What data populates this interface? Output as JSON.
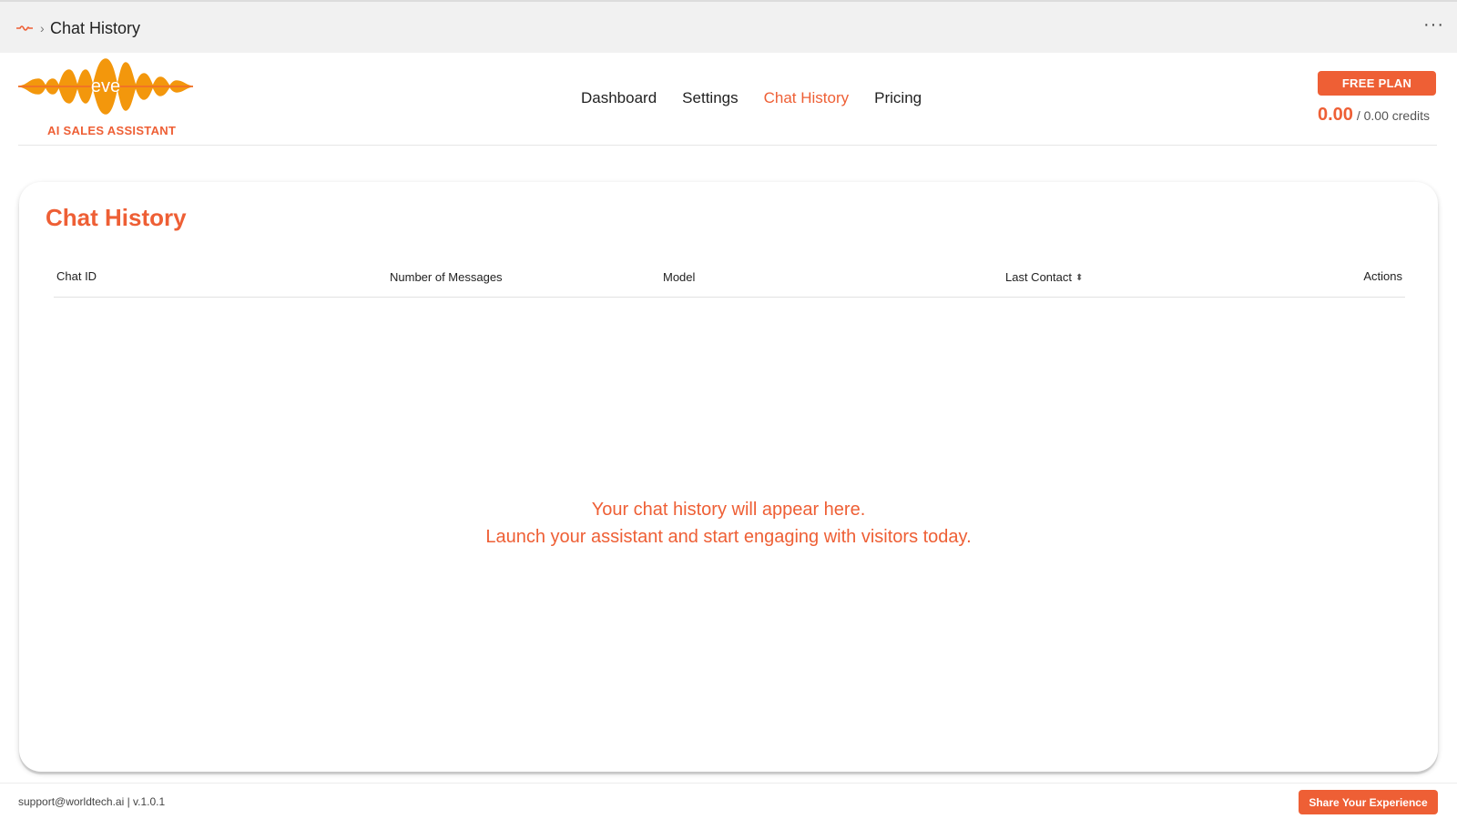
{
  "topbar": {
    "breadcrumb": "Chat History",
    "separator": "›",
    "more": "···",
    "app_icon": "eve-wave-icon"
  },
  "brand": {
    "logo_text": "eve",
    "subtitle": "AI SALES ASSISTANT",
    "accent_color": "#ee5f35",
    "logo_color": "#f39200"
  },
  "nav": {
    "items": [
      {
        "label": "Dashboard",
        "active": false
      },
      {
        "label": "Settings",
        "active": false
      },
      {
        "label": "Chat History",
        "active": true
      },
      {
        "label": "Pricing",
        "active": false
      }
    ]
  },
  "plan": {
    "button_label": "FREE PLAN",
    "credits_used": "0.00",
    "credits_total": "/ 0.00 credits"
  },
  "page": {
    "title": "Chat History",
    "columns": [
      "Chat ID",
      "Number of Messages",
      "Model",
      "Last Contact",
      "Actions"
    ],
    "sort_icon": "⬍",
    "empty_line1": "Your chat history will appear here.",
    "empty_line2": "Launch your assistant and start engaging with visitors today."
  },
  "footer": {
    "info": "support@worldtech.ai | v.1.0.1",
    "share_label": "Share Your Experience"
  }
}
